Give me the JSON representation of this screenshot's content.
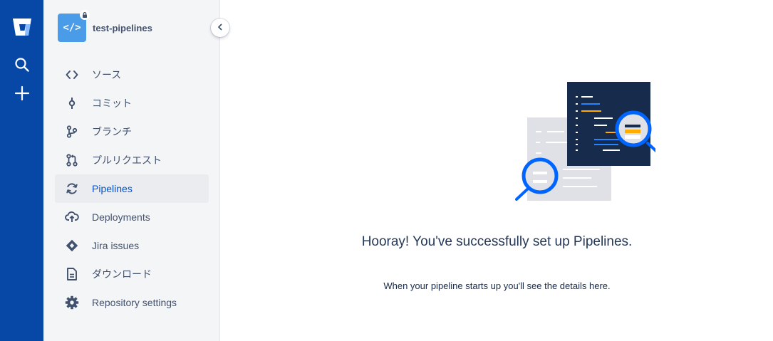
{
  "app": {
    "brand_color": "#0747a6",
    "accent_color": "#0052cc",
    "global_nav": {
      "logo_icon": "bitbucket-logo-icon",
      "search_icon": "search-icon",
      "create_icon": "plus-icon"
    }
  },
  "repo": {
    "name": "test-pipelines",
    "avatar_glyph": "</>",
    "private_icon": "lock-icon"
  },
  "sidebar": {
    "items": [
      {
        "label": "ソース",
        "icon": "code-icon",
        "active": false
      },
      {
        "label": "コミット",
        "icon": "commit-icon",
        "active": false
      },
      {
        "label": "ブランチ",
        "icon": "branch-icon",
        "active": false
      },
      {
        "label": "プルリクエスト",
        "icon": "pull-request-icon",
        "active": false
      },
      {
        "label": "Pipelines",
        "icon": "pipelines-icon",
        "active": true
      },
      {
        "label": "Deployments",
        "icon": "cloud-upload-icon",
        "active": false
      },
      {
        "label": "Jira issues",
        "icon": "jira-icon",
        "active": false
      },
      {
        "label": "ダウンロード",
        "icon": "download-file-icon",
        "active": false
      },
      {
        "label": "Repository settings",
        "icon": "gear-icon",
        "active": false
      }
    ],
    "collapse_icon": "chevron-left-icon"
  },
  "main": {
    "title": "Hooray! You've successfully set up Pipelines.",
    "description": "When your pipeline starts up you'll see the details here."
  }
}
